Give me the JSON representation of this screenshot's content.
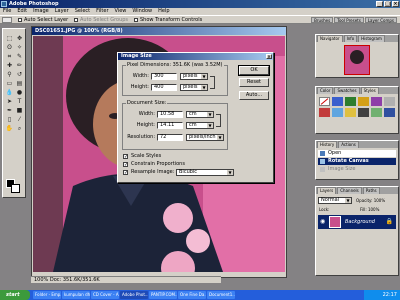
{
  "app": {
    "title": "Adobe Photoshop"
  },
  "menu": [
    "File",
    "Edit",
    "Image",
    "Layer",
    "Select",
    "Filter",
    "View",
    "Window",
    "Help"
  ],
  "options": {
    "auto_select_layer": "Auto Select Layer",
    "auto_select_groups": "Auto Select Groups",
    "show_transform": "Show Transform Controls",
    "wells": [
      "Brushes",
      "Tool Presets",
      "Layer Comps"
    ]
  },
  "document": {
    "title": "DSC01651.JPG @ 100% (RGB/8)",
    "status": "100%     Doc: 351.6K/351.6K"
  },
  "dialog": {
    "title": "Image Size",
    "pixel_dimensions": "Pixel Dimensions:  351.6K (was 3.52M)",
    "width_label": "Width:",
    "height_label": "Height:",
    "px_width": "300",
    "px_height": "400",
    "px_unit": "pixels",
    "document_size": "Document Size:",
    "doc_width": "10.58",
    "doc_height": "14.11",
    "doc_unit": "cm",
    "resolution_label": "Resolution:",
    "resolution": "72",
    "resolution_unit": "pixels/inch",
    "scale_styles": "Scale Styles",
    "constrain": "Constrain Proportions",
    "resample": "Resample Image:",
    "resample_method": "Bicubic",
    "ok": "OK",
    "reset": "Reset",
    "auto": "Auto..."
  },
  "navigator": {
    "tabs": [
      "Navigator",
      "Info",
      "Histogram"
    ]
  },
  "color_panel": {
    "tabs": [
      "Color",
      "Swatches",
      "Styles"
    ]
  },
  "history": {
    "tabs": [
      "History",
      "Actions"
    ],
    "items": [
      "Open",
      "Rotate Canvas",
      "Image Size"
    ],
    "active_index": 1
  },
  "layers": {
    "tabs": [
      "Layers",
      "Channels",
      "Paths"
    ],
    "mode": "Normal",
    "opacity_label": "Opacity: 100%",
    "lock_label": "Lock:",
    "fill_label": "Fill: 100%",
    "layer_name": "Background"
  },
  "taskbar": {
    "start": "start",
    "buttons": [
      "Folder - Emp...",
      "kumpulan dhon...",
      "CD Cover - A...",
      "Adobe Phot...",
      "PANTIP.COM...",
      "One Fine Da...",
      "Document1..."
    ],
    "active_index": 3,
    "time": "22:17"
  }
}
